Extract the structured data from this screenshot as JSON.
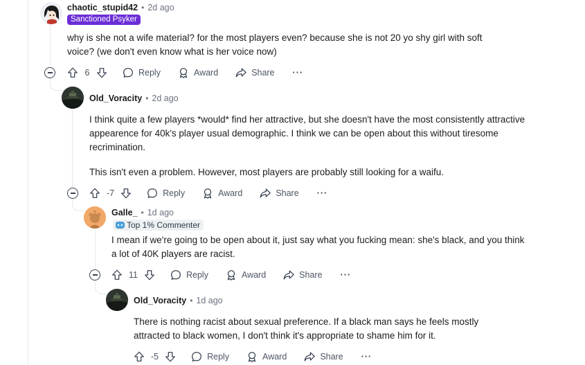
{
  "comments": [
    {
      "username": "chaotic_stupid42",
      "time": "2d ago",
      "flair": "Sanctioned Psyker",
      "body": [
        "why is she not a wife material? for the most players even? because she is not 20 yo shy girl with soft voice? (we don't even know what is her voice now)"
      ],
      "votes": "6"
    },
    {
      "username": "Old_Voracity",
      "time": "2d ago",
      "body": [
        "I think quite a few players *would* find her attractive, but she doesn't have the most consistently attractive appearence for 40k's player usual demographic. I think we can be open about this without tiresome recrimination.",
        "This isn't even a problem. However, most players are probably still looking for a waifu."
      ],
      "votes": "-7"
    },
    {
      "username": "Galle_",
      "time": "1d ago",
      "flair": "Top 1% Commenter",
      "body": [
        "I mean if we're going to be open about it, just say what you fucking mean: she's black, and you think a lot of 40K players are racist."
      ],
      "votes": "11"
    },
    {
      "username": "Old_Voracity",
      "time": "1d ago",
      "body": [
        "There is nothing racist about sexual preference. If a black man says he feels mostly attracted to black women, I don't think it's appropriate to shame him for it."
      ],
      "votes": "-5"
    }
  ],
  "actions": {
    "reply": "Reply",
    "award": "Award",
    "share": "Share",
    "more": "···"
  },
  "meta": {
    "separator": "•"
  },
  "colors": {
    "flair_purple": "#6a2ed6",
    "thread_line": "#e5e7eb",
    "muted": "#6b7280"
  },
  "icons": [
    "upvote-icon",
    "downvote-icon",
    "reply-icon",
    "award-icon",
    "share-icon",
    "more-icon",
    "collapse-icon",
    "top-commenter-icon"
  ]
}
